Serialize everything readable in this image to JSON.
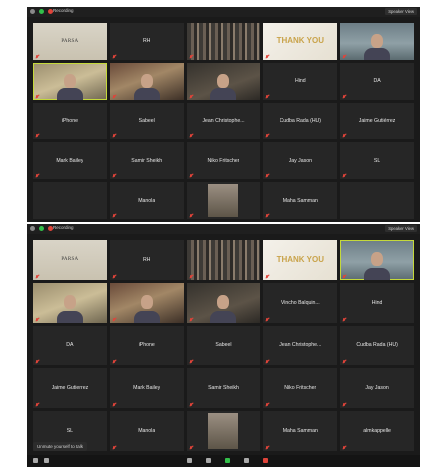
{
  "window_top": {
    "recording_label": "Recording",
    "view_control": "Speaker View",
    "tiles": [
      {
        "type": "video",
        "look": "logo",
        "name": "",
        "logo_text": "PARSA"
      },
      {
        "type": "name",
        "name": "RH"
      },
      {
        "type": "video",
        "look": "shelf",
        "name": ""
      },
      {
        "type": "video",
        "look": "thank",
        "name": "",
        "big_text": "THANK YOU"
      },
      {
        "type": "video",
        "look": "man",
        "name": ""
      },
      {
        "type": "video",
        "look": "room",
        "name": "",
        "speaker": true
      },
      {
        "type": "video",
        "look": "room2",
        "name": ""
      },
      {
        "type": "video",
        "look": "dim",
        "name": ""
      },
      {
        "type": "name",
        "name": "Hind"
      },
      {
        "type": "name",
        "name": "DA"
      },
      {
        "type": "name",
        "name": "iPhone"
      },
      {
        "type": "name",
        "name": "Sabeel"
      },
      {
        "type": "name",
        "name": "Jean Christophe..."
      },
      {
        "type": "name",
        "name": "Cudba Rada (HU)"
      },
      {
        "type": "name",
        "name": "Jaime Gutiérrez"
      },
      {
        "type": "name",
        "name": "Mark Bailey"
      },
      {
        "type": "name",
        "name": "Samir Sheikh"
      },
      {
        "type": "name",
        "name": "Niko Fritscher"
      },
      {
        "type": "name",
        "name": "Jay Jason"
      },
      {
        "type": "name",
        "name": "SL"
      },
      {
        "type": "empty",
        "name": ""
      },
      {
        "type": "name",
        "name": "Manola"
      },
      {
        "type": "thumb",
        "name": ""
      },
      {
        "type": "name",
        "name": "Maha Samman"
      },
      {
        "type": "empty",
        "name": ""
      }
    ]
  },
  "window_bottom": {
    "recording_label": "Recording",
    "view_control": "Speaker View",
    "unmute_tip": "Unmute yourself to talk",
    "tiles": [
      {
        "type": "video",
        "look": "logo",
        "name": "",
        "logo_text": "PARSA"
      },
      {
        "type": "name",
        "name": "RH"
      },
      {
        "type": "video",
        "look": "shelf",
        "name": ""
      },
      {
        "type": "video",
        "look": "thank",
        "name": "",
        "big_text": "THANK YOU"
      },
      {
        "type": "video",
        "look": "man",
        "name": "",
        "speaker": true
      },
      {
        "type": "video",
        "look": "room",
        "name": ""
      },
      {
        "type": "video",
        "look": "room2",
        "name": ""
      },
      {
        "type": "video",
        "look": "dim",
        "name": ""
      },
      {
        "type": "name",
        "name": "Vincho Balquin..."
      },
      {
        "type": "name",
        "name": "Hind"
      },
      {
        "type": "name",
        "name": "DA"
      },
      {
        "type": "name",
        "name": "iPhone"
      },
      {
        "type": "name",
        "name": "Sabeel"
      },
      {
        "type": "name",
        "name": "Jean Christophe..."
      },
      {
        "type": "name",
        "name": "Cudba Rada (HU)"
      },
      {
        "type": "name",
        "name": "Jaime Gutierrez"
      },
      {
        "type": "name",
        "name": "Mark Bailey"
      },
      {
        "type": "name",
        "name": "Samir Sheikh"
      },
      {
        "type": "name",
        "name": "Niko Fritscher"
      },
      {
        "type": "name",
        "name": "Jay Jason"
      },
      {
        "type": "name",
        "name": "SL"
      },
      {
        "type": "name",
        "name": "Manola"
      },
      {
        "type": "thumb",
        "name": ""
      },
      {
        "type": "name",
        "name": "Maha Samman"
      },
      {
        "type": "name",
        "name": "almkappelle"
      }
    ]
  },
  "colors": {
    "speaker_outline": "#c5d93b",
    "tile_bg": "#262626",
    "window_bg": "#1a1a1a",
    "mute_red": "#e0443a",
    "green": "#33c04a"
  },
  "icons": [
    "mute-mic-icon",
    "record-dot-icon",
    "speaker-view-icon"
  ]
}
